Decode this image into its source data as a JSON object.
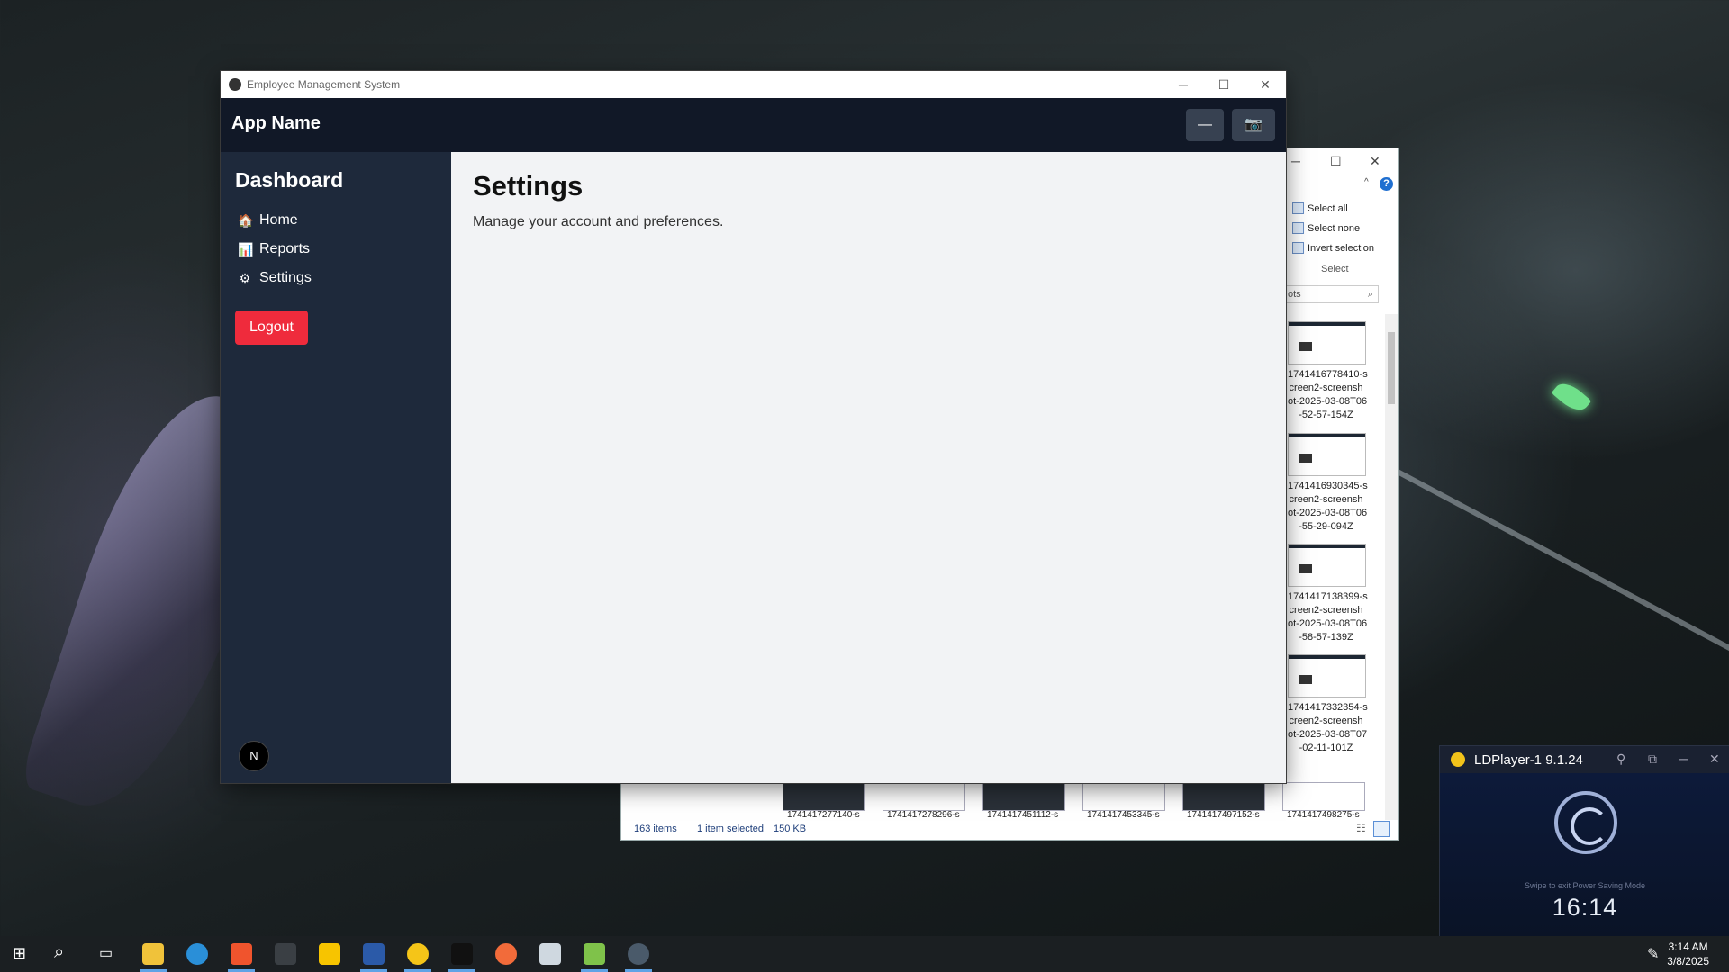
{
  "window": {
    "title": "Employee Management System",
    "controls": {
      "minimize": "─",
      "maximize": "☐",
      "close": "✕"
    }
  },
  "navbar": {
    "app_name": "App Name",
    "minimize_symbol": "—",
    "camera_symbol": "📷"
  },
  "sidebar": {
    "title": "Dashboard",
    "items": [
      {
        "icon": "🏠",
        "icon_name": "home-icon",
        "label": "Home"
      },
      {
        "icon": "📊",
        "icon_name": "chart-icon",
        "label": "Reports"
      },
      {
        "icon": "⚙",
        "icon_name": "gear-icon",
        "label": "Settings"
      }
    ],
    "logout_label": "Logout",
    "logo_letter": "N"
  },
  "main": {
    "title": "Settings",
    "description": "Manage your account and preferences."
  },
  "explorer": {
    "controls": {
      "minimize": "─",
      "maximize": "☐",
      "close": "✕"
    },
    "ribbon": {
      "select_all": "Select all",
      "select_none": "Select none",
      "invert_selection": "Invert selection",
      "group_label": "Select"
    },
    "help_symbol": "?",
    "search_text": "ots",
    "files": [
      "1741416778410-s\ncreen2-screensh\not-2025-03-08T06\n-52-57-154Z",
      "1741416930345-s\ncreen2-screensh\not-2025-03-08T06\n-55-29-094Z",
      "1741417138399-s\ncreen2-screensh\not-2025-03-08T06\n-58-57-139Z",
      "1741417332354-s\ncreen2-screensh\not-2025-03-08T07\n-02-11-101Z"
    ],
    "bottom_files": [
      "1741417277140-s",
      "1741417278296-s",
      "1741417451112-s",
      "1741417453345-s",
      "1741417497152-s",
      "1741417498275-s"
    ],
    "status": {
      "items": "163 items",
      "selected": "1 item selected",
      "size": "150 KB"
    }
  },
  "ldplayer": {
    "title": "LDPlayer-1 9.1.24",
    "swipe_text": "Swipe to exit Power Saving Mode",
    "time": "16:14"
  },
  "taskbar": {
    "clock_time": "3:14 AM",
    "clock_date": "3/8/2025",
    "apps": [
      "start-icon",
      "search-icon",
      "task-view-icon",
      "file-explorer-icon",
      "edge-icon",
      "brave-icon",
      "terminal-icon",
      "sticky-notes-icon",
      "vscode-icon",
      "ldplayer-icon",
      "capcut-icon",
      "postman-icon",
      "mail-icon",
      "notepad-icon",
      "electron-icon"
    ]
  },
  "colors": {
    "navbar": "#111827",
    "sidebar": "#1e293b",
    "logout": "#ef2b3c",
    "main_bg": "#f2f3f5"
  }
}
